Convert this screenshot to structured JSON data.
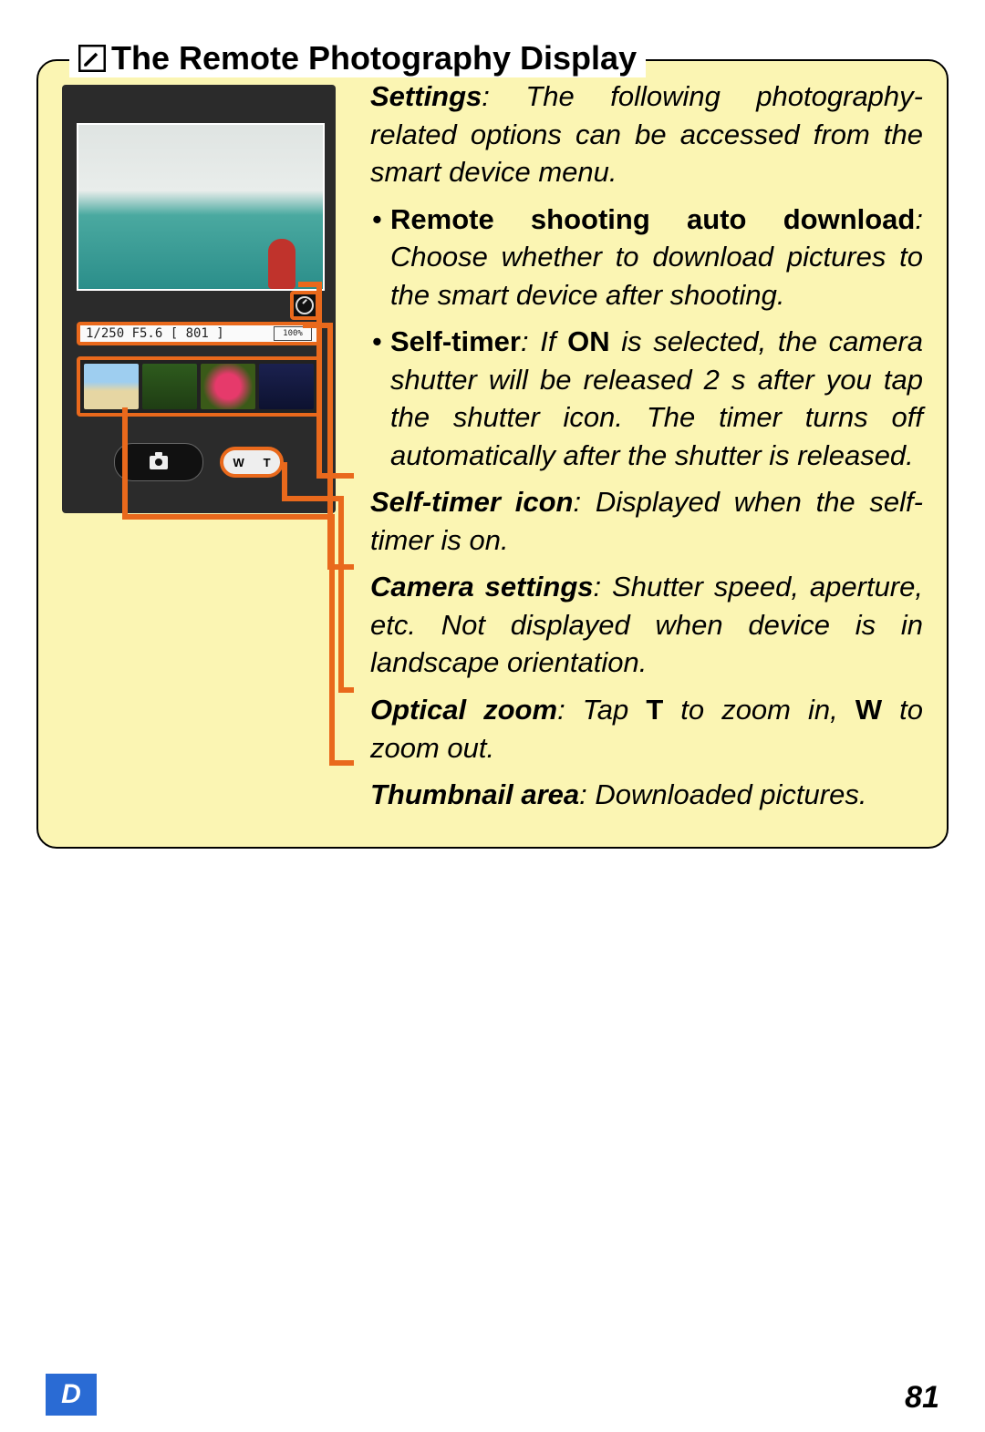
{
  "title_icon": "pencil-icon",
  "title": "The Remote Photography Display",
  "illustration": {
    "settings_bar": {
      "left_text": "1/250  F5.6  [ 801 ]",
      "battery_text": "100%"
    },
    "zoom_labels": {
      "wide": "W",
      "tele": "T"
    }
  },
  "paras": {
    "intro_label": "Settings",
    "intro_body": ": The following photography-related options can be accessed from the smart device menu.",
    "b1_label": "Remote shooting auto download",
    "b1_body": ": Choose whether to download pictures to the smart device after shooting.",
    "b2_label": "Self-timer",
    "b2_body_a": ": If ",
    "b2_on": "ON",
    "b2_body_b": " is selected, the camera shutter will be released 2 s after you tap the shutter icon. The timer turns off automatically after the shutter is released.",
    "c1_label": "Self-timer icon",
    "c1_body": ": Displayed when the self-timer is on.",
    "c2_label": "Camera settings",
    "c2_body": ": Shutter speed, aperture, etc. Not displayed when device is in landscape orientation.",
    "c3_label": "Optical zoom",
    "c3_body_a": ": Tap ",
    "c3_t": "T",
    "c3_body_b": " to zoom in, ",
    "c3_w": "W",
    "c3_body_c": " to zoom out.",
    "c4_label": "Thumbnail area",
    "c4_body": ": Downloaded pictures."
  },
  "footer": {
    "tab": "D",
    "page": "81"
  }
}
